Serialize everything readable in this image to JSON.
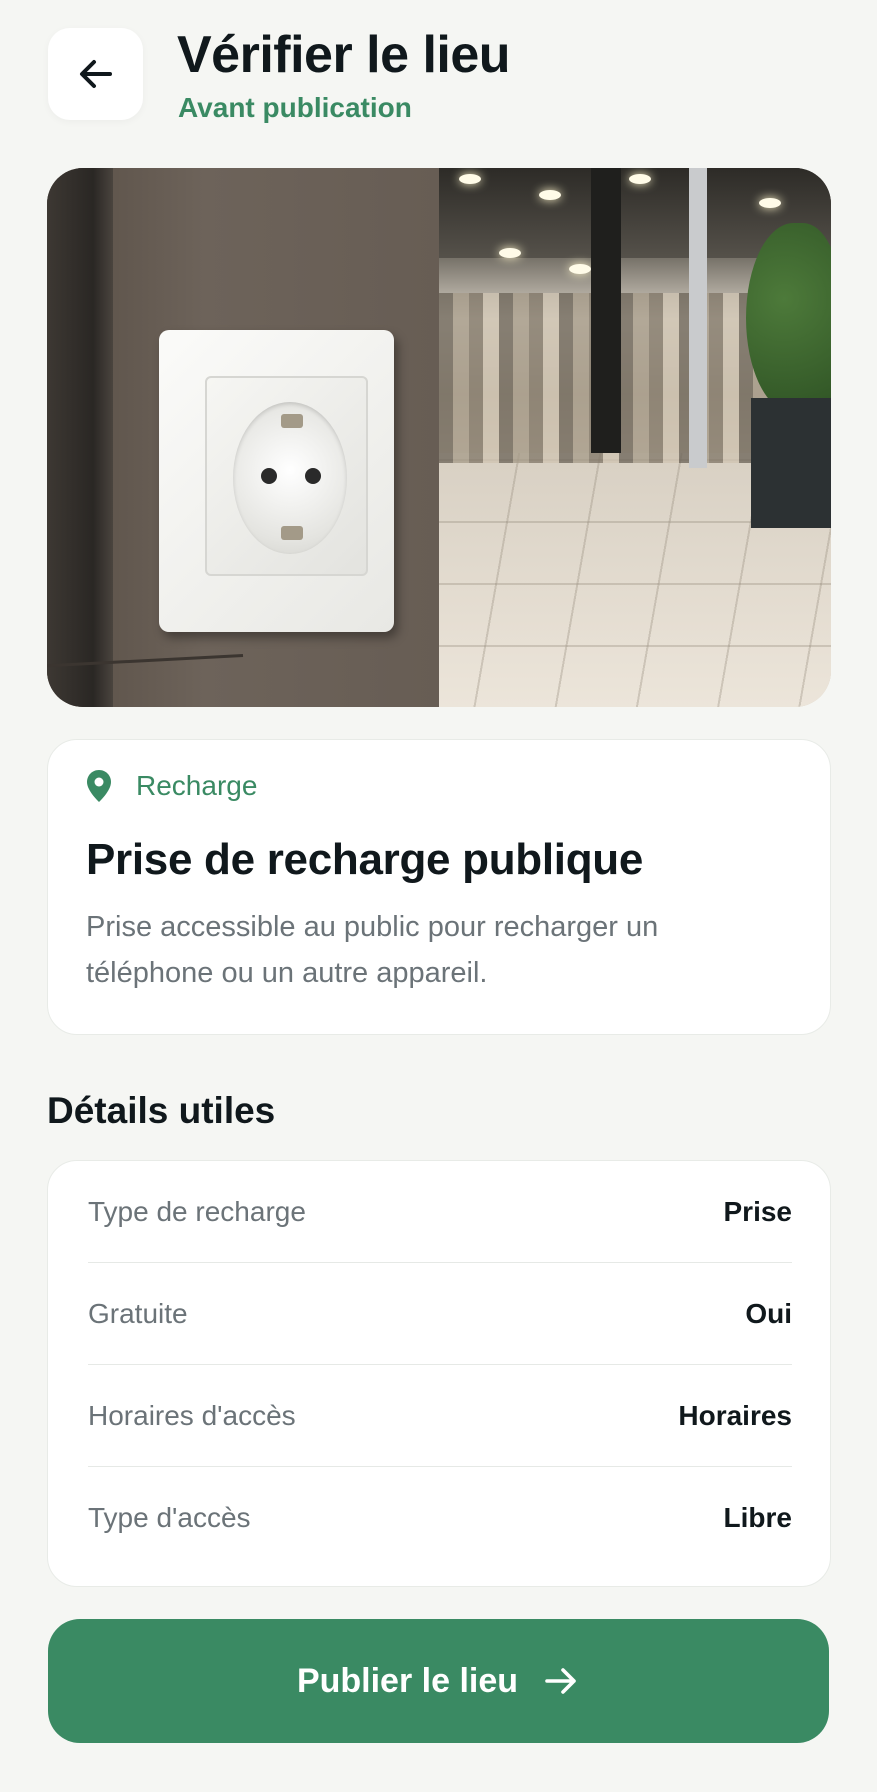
{
  "header": {
    "back_icon": "arrow-left-icon",
    "title": "Vérifier le lieu",
    "subtitle": "Avant publication"
  },
  "hero": {
    "image_description": "photo"
  },
  "place": {
    "category_icon": "map-pin-icon",
    "category": "Recharge",
    "title": "Prise de recharge publique",
    "description": "Prise accessible au public pour recharger un téléphone ou un autre appareil."
  },
  "details": {
    "section_title": "Détails utiles",
    "rows": [
      {
        "label": "Type de recharge",
        "value": "Prise"
      },
      {
        "label": "Gratuite",
        "value": "Oui"
      },
      {
        "label": "Horaires d'accès",
        "value": "Horaires"
      },
      {
        "label": "Type d'accès",
        "value": "Libre"
      }
    ]
  },
  "publish": {
    "label": "Publier le lieu",
    "icon": "arrow-right-icon"
  },
  "colors": {
    "accent": "#3a8a63",
    "background": "#f5f6f3",
    "text": "#10181c",
    "muted": "#6b7378"
  }
}
